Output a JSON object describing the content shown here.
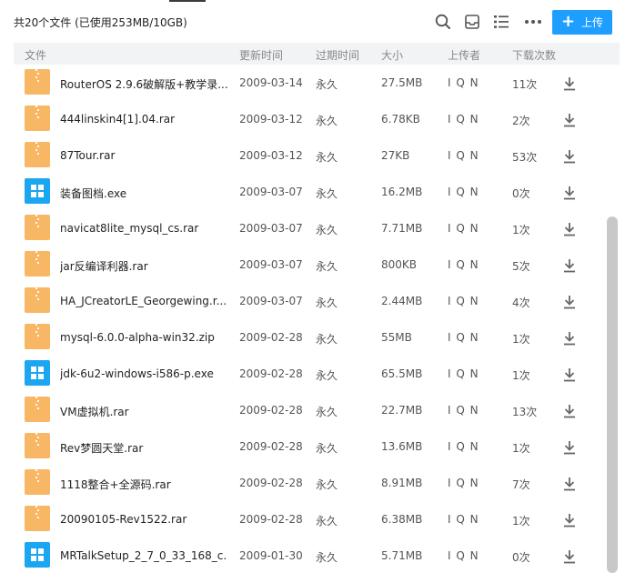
{
  "header": {
    "summary_prefix": "共20个文件",
    "summary_usage": "(已使用253MB/10GB)",
    "upload_label": "上传",
    "icons": [
      "search-icon",
      "inbox-icon",
      "list-view-icon",
      "more-icon"
    ]
  },
  "columns": {
    "name": "文件",
    "updated": "更新时间",
    "expires": "过期时间",
    "size": "大小",
    "uploader": "上传者",
    "downloads": "下载次数"
  },
  "colors": {
    "accent": "#1e9fff",
    "archive": "#f8b764",
    "exe": "#1aa6f0"
  },
  "files": [
    {
      "name": "RouterOS 2.9.6破解版+教学录...",
      "date": "2009-03-14",
      "expires": "永久",
      "size": "27.5MB",
      "uploader": "I Q N",
      "downloads": "11次",
      "type": "archive"
    },
    {
      "name": "444linskin4[1].04.rar",
      "date": "2009-03-12",
      "expires": "永久",
      "size": "6.78KB",
      "uploader": "I Q N",
      "downloads": "2次",
      "type": "archive"
    },
    {
      "name": "87Tour.rar",
      "date": "2009-03-12",
      "expires": "永久",
      "size": "27KB",
      "uploader": "I Q N",
      "downloads": "53次",
      "type": "archive"
    },
    {
      "name": "装备图档.exe",
      "date": "2009-03-07",
      "expires": "永久",
      "size": "16.2MB",
      "uploader": "I Q N",
      "downloads": "0次",
      "type": "exe"
    },
    {
      "name": "navicat8lite_mysql_cs.rar",
      "date": "2009-03-07",
      "expires": "永久",
      "size": "7.71MB",
      "uploader": "I Q N",
      "downloads": "1次",
      "type": "archive"
    },
    {
      "name": "jar反编译利器.rar",
      "date": "2009-03-07",
      "expires": "永久",
      "size": "800KB",
      "uploader": "I Q N",
      "downloads": "5次",
      "type": "archive"
    },
    {
      "name": "HA_JCreatorLE_Georgewing.r...",
      "date": "2009-03-07",
      "expires": "永久",
      "size": "2.44MB",
      "uploader": "I Q N",
      "downloads": "4次",
      "type": "archive"
    },
    {
      "name": "mysql-6.0.0-alpha-win32.zip",
      "date": "2009-02-28",
      "expires": "永久",
      "size": "55MB",
      "uploader": "I Q N",
      "downloads": "1次",
      "type": "archive"
    },
    {
      "name": "jdk-6u2-windows-i586-p.exe",
      "date": "2009-02-28",
      "expires": "永久",
      "size": "65.5MB",
      "uploader": "I Q N",
      "downloads": "1次",
      "type": "exe"
    },
    {
      "name": "VM虚拟机.rar",
      "date": "2009-02-28",
      "expires": "永久",
      "size": "22.7MB",
      "uploader": "I Q N",
      "downloads": "13次",
      "type": "archive"
    },
    {
      "name": "Rev梦圆天堂.rar",
      "date": "2009-02-28",
      "expires": "永久",
      "size": "13.6MB",
      "uploader": "I Q N",
      "downloads": "1次",
      "type": "archive"
    },
    {
      "name": "1118整合+全源码.rar",
      "date": "2009-02-28",
      "expires": "永久",
      "size": "8.91MB",
      "uploader": "I Q N",
      "downloads": "7次",
      "type": "archive"
    },
    {
      "name": "20090105-Rev1522.rar",
      "date": "2009-02-28",
      "expires": "永久",
      "size": "6.38MB",
      "uploader": "I Q N",
      "downloads": "1次",
      "type": "archive"
    },
    {
      "name": "MRTalkSetup_2_7_0_33_168_c...",
      "date": "2009-01-30",
      "expires": "永久",
      "size": "5.71MB",
      "uploader": "I Q N",
      "downloads": "0次",
      "type": "exe"
    }
  ]
}
